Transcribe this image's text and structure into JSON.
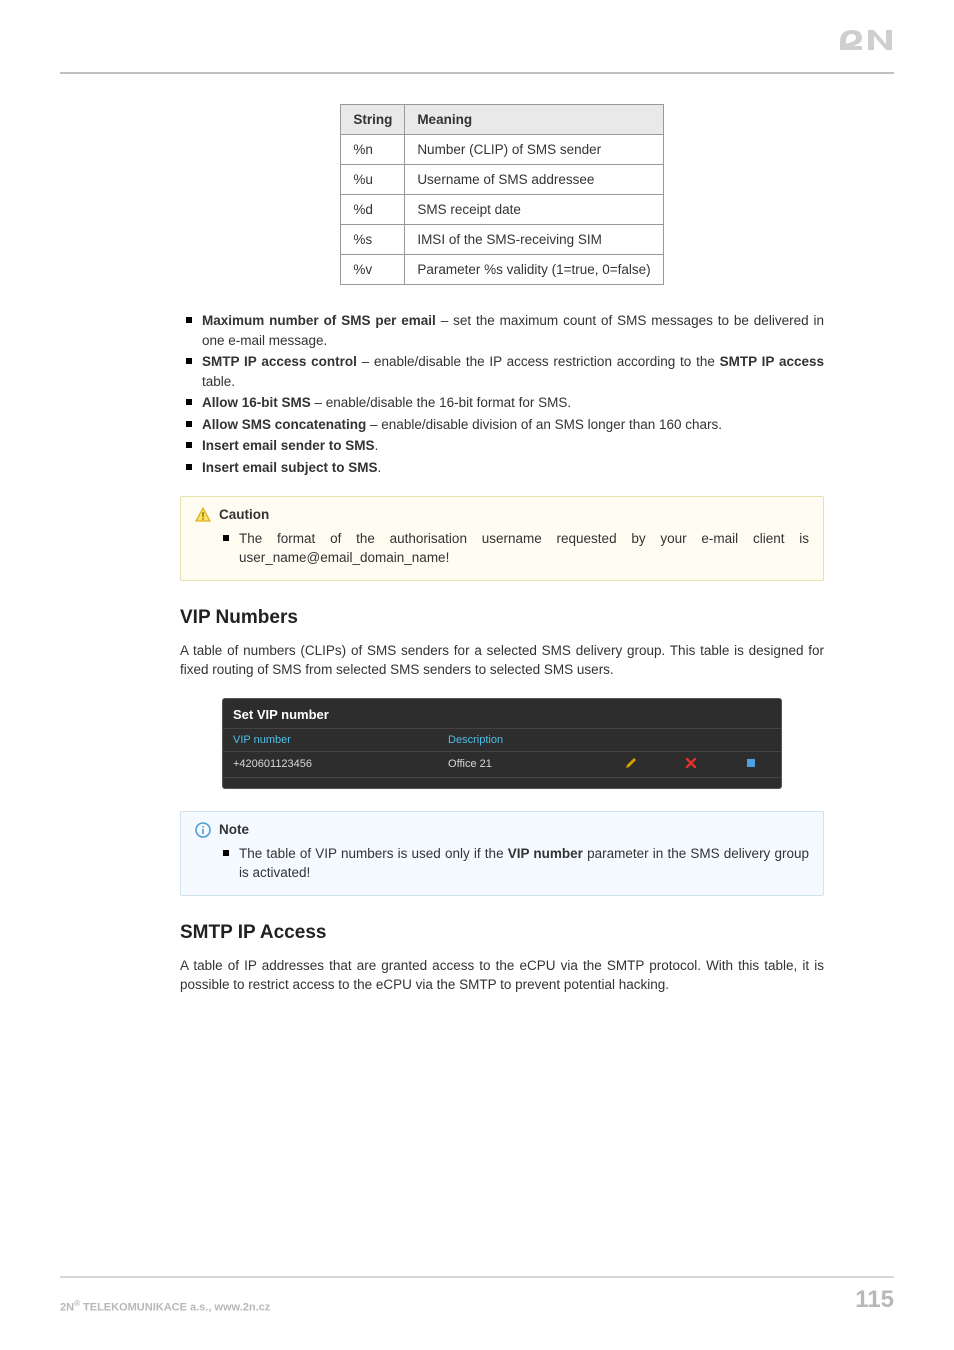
{
  "logo_text": "2N",
  "string_table": {
    "headers": [
      "String",
      "Meaning"
    ],
    "rows": [
      [
        "%n",
        "Number (CLIP) of SMS sender"
      ],
      [
        "%u",
        "Username of SMS addressee"
      ],
      [
        "%d",
        "SMS receipt date"
      ],
      [
        "%s",
        "IMSI of the SMS-receiving SIM"
      ],
      [
        "%v",
        "Parameter %s validity (1=true, 0=false)"
      ]
    ]
  },
  "bullets": [
    {
      "bold": "Maximum number of SMS per email",
      "rest": " – set the maximum count of SMS messages to be delivered in one e-mail message."
    },
    {
      "bold": "SMTP IP access control",
      "rest_pre": " – enable/disable the IP access restriction according to the ",
      "bold2": "SMTP IP access",
      "rest_post": " table."
    },
    {
      "bold": "Allow 16-bit SMS",
      "rest": " – enable/disable the 16-bit format for SMS."
    },
    {
      "bold": "Allow SMS concatenating",
      "rest": " – enable/disable division of an SMS longer than 160 chars."
    },
    {
      "bold": "Insert email sender to SMS",
      "rest": "."
    },
    {
      "bold": "Insert email subject to SMS",
      "rest": "."
    }
  ],
  "caution": {
    "title": "Caution",
    "item": "The format of the authorisation username requested by your e-mail client is user_name@email_domain_name!"
  },
  "section_vip": {
    "heading": "VIP Numbers",
    "para": "A table of numbers (CLIPs) of SMS senders for a selected SMS delivery group. This table is designed for fixed routing of SMS from selected SMS senders to selected SMS users."
  },
  "vip_widget": {
    "title": "Set VIP number",
    "cols": [
      "VIP number",
      "Description"
    ],
    "row": {
      "number": "+420601123456",
      "desc": "Office 21"
    },
    "icons": {
      "edit": "edit-icon",
      "delete": "delete-icon",
      "stop": "stop-icon"
    }
  },
  "note": {
    "title": "Note",
    "item_pre": "The table of VIP numbers is used only if the ",
    "item_bold": "VIP number",
    "item_post": " parameter in the SMS delivery group is activated!"
  },
  "section_smtp": {
    "heading": "SMTP IP Access",
    "para": "A table of IP addresses that are granted access to the eCPU via the SMTP protocol. With this table, it is possible to restrict access to the eCPU via the SMTP to prevent potential hacking."
  },
  "footer": {
    "left_pre": "2N",
    "left_sup": "®",
    "left_post": " TELEKOMUNIKACE a.s., www.2n.cz",
    "page": "115"
  }
}
